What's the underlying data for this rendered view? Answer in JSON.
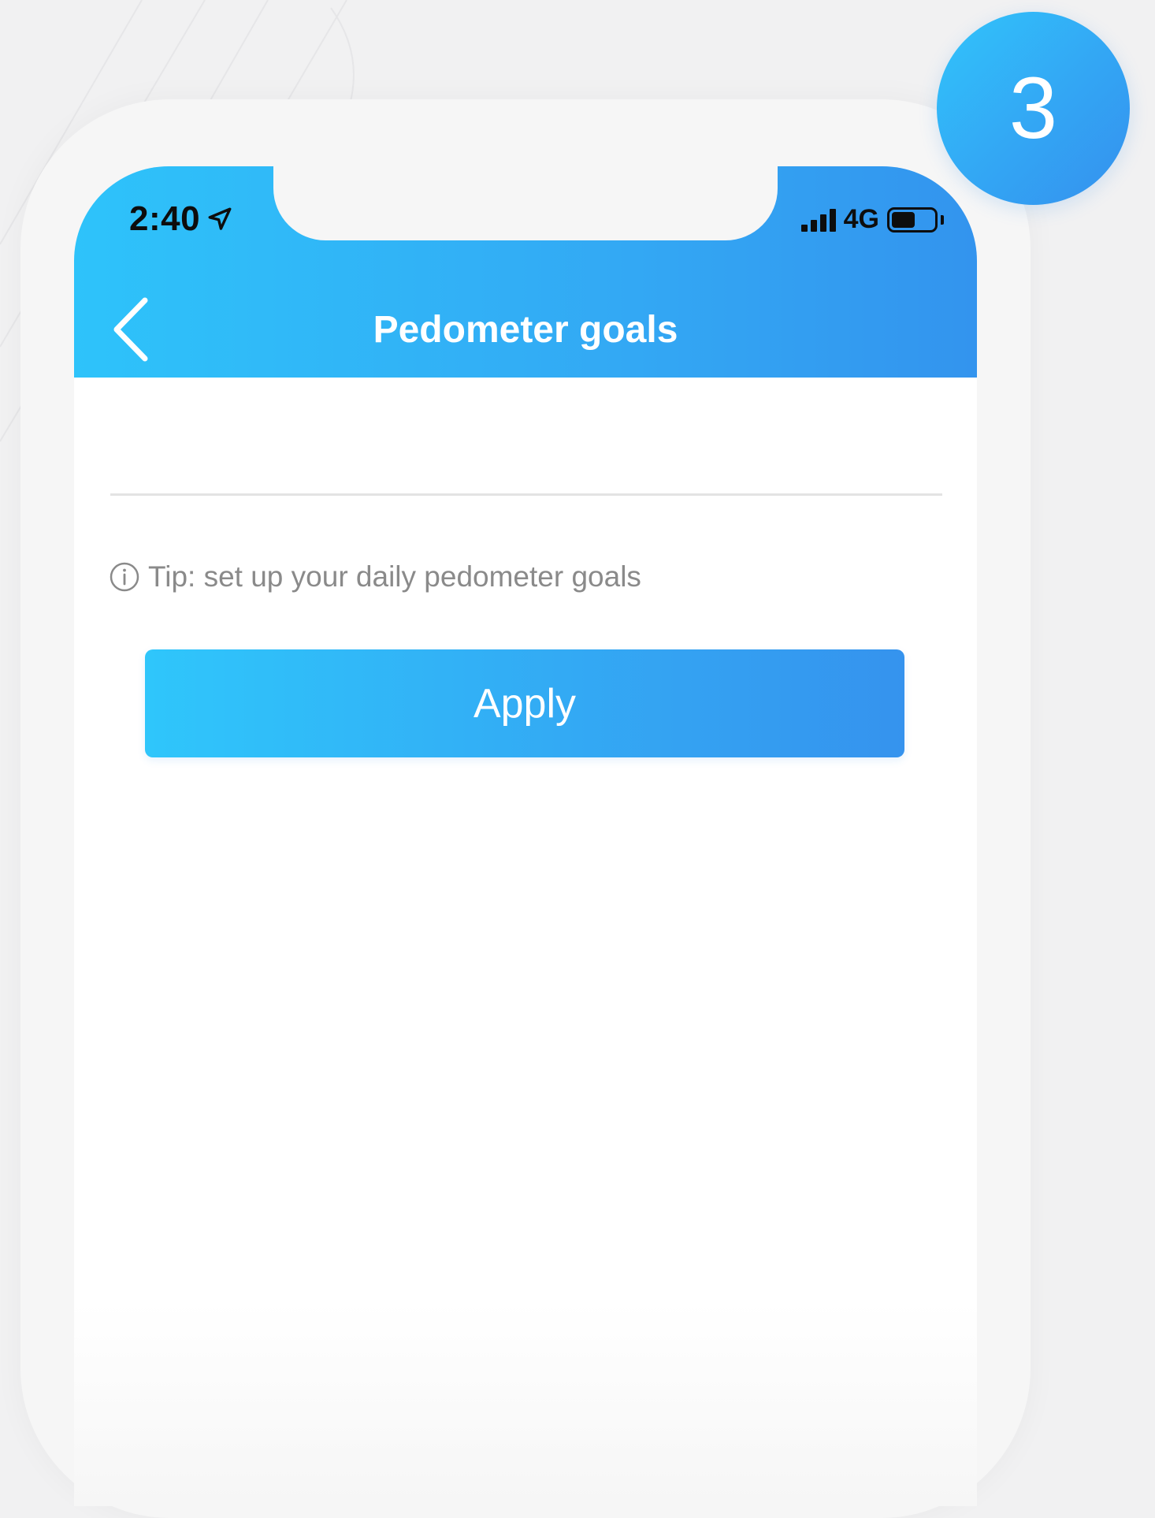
{
  "step_badge": {
    "number": "3"
  },
  "status_bar": {
    "time": "2:40",
    "network": "4G"
  },
  "nav": {
    "title": "Pedometer goals"
  },
  "goal_input": {
    "value": "",
    "placeholder": ""
  },
  "tip": {
    "text": "Tip: set up your daily pedometer goals"
  },
  "apply_button": {
    "label": "Apply"
  },
  "colors": {
    "accent_start": "#2ec3fa",
    "accent_end": "#3394ee",
    "tip_text": "#8a8a8a"
  },
  "icons": {
    "back": "chevron-left-icon",
    "location": "location-arrow-icon",
    "signal": "signal-bars-icon",
    "battery": "battery-icon",
    "info": "info-icon"
  }
}
